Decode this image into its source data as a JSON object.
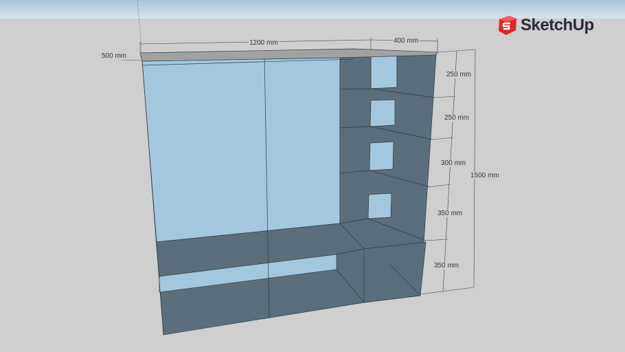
{
  "brand": {
    "name": "SketchUp",
    "color": "#e4232b"
  },
  "colors": {
    "back_panel": "#a3c7de",
    "panel": "#5b6e7b",
    "top": "#a2a2a2",
    "ground": "#cfcfcf",
    "sky": "#b9d2de"
  },
  "dimensions": {
    "width": "1200 mm",
    "column_width": "400 mm",
    "depth": "500 mm",
    "shelves": [
      "250 mm",
      "250 mm",
      "300 mm",
      "350 mm",
      "350 mm"
    ],
    "height": "1500 mm"
  }
}
